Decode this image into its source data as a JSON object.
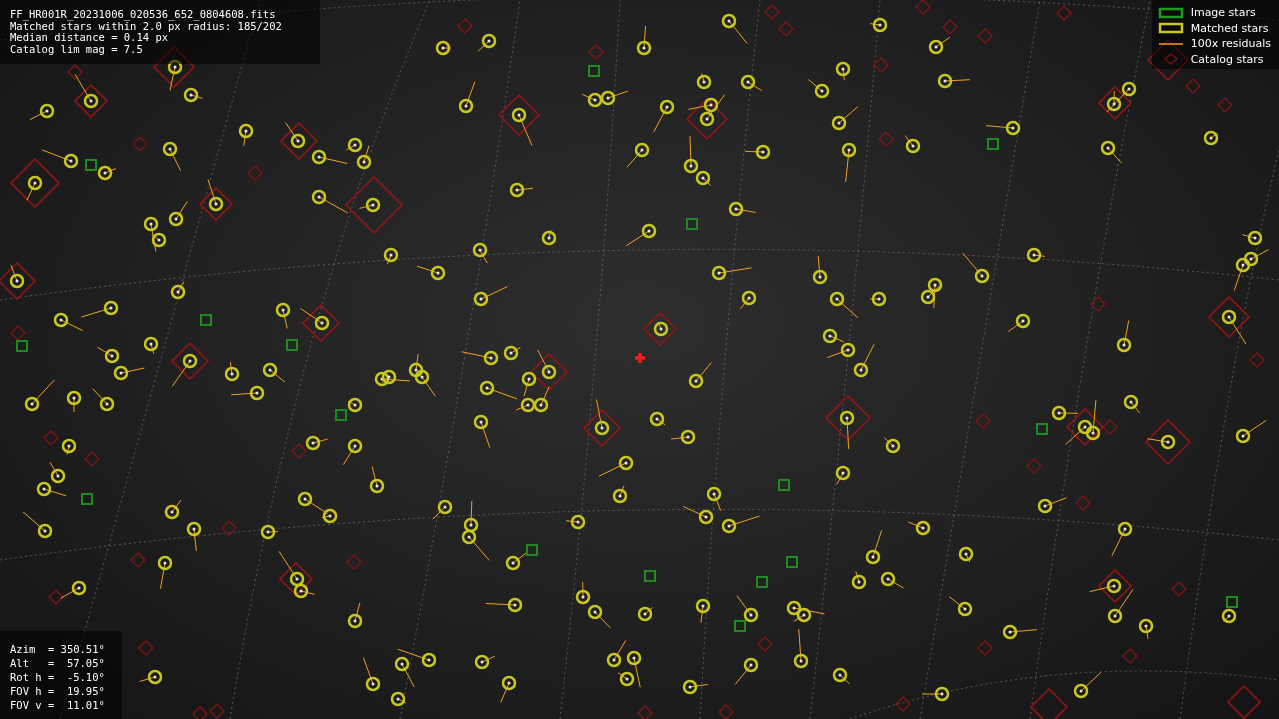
{
  "info": {
    "lines": [
      "FF_HR001R_20231006_020536_652_0804608.fits",
      "Matched stars within 2.0 px radius: 185/202",
      "Median distance = 0.14 px",
      "Catalog lim mag = 7.5"
    ]
  },
  "legend": [
    {
      "kind": "image",
      "label": "Image stars"
    },
    {
      "kind": "matched",
      "label": "Matched stars"
    },
    {
      "kind": "residual",
      "label": "100x residuals"
    },
    {
      "kind": "catalog",
      "label": "Catalog stars"
    }
  ],
  "pointing": {
    "lines": [
      "Azim  = 350.51°",
      "Alt   =  57.05°",
      "Rot h =  -5.10°",
      "FOV h =  19.95°",
      "FOV v =  11.01°"
    ]
  }
}
